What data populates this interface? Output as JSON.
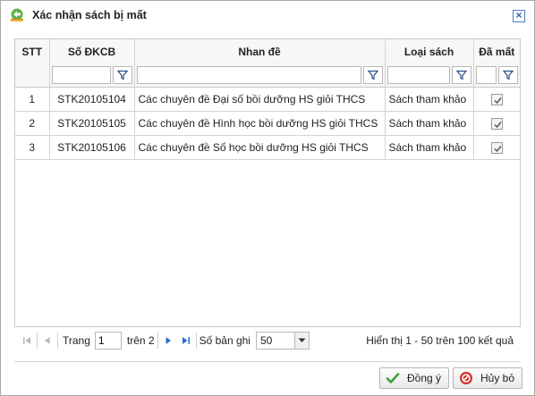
{
  "dialog": {
    "title": "Xác nhận sách bị mất",
    "close_label": "×"
  },
  "table": {
    "columns": [
      "STT",
      "Số ĐKCB",
      "Nhan đề",
      "Loại sách",
      "Đã mất"
    ],
    "rows": [
      {
        "stt": "1",
        "code": "STK20105104",
        "title": "Các chuyên đề Đại số bồi dưỡng HS giỏi THCS",
        "type": "Sách tham khảo",
        "lost": true
      },
      {
        "stt": "2",
        "code": "STK20105105",
        "title": "Các chuyên đề Hình học bồi dưỡng HS giỏi THCS",
        "type": "Sách tham khảo",
        "lost": true
      },
      {
        "stt": "3",
        "code": "STK20105106",
        "title": "Các chuyên đề Số học bồi dưỡng HS giỏi THCS",
        "type": "Sách tham khảo",
        "lost": true
      }
    ]
  },
  "pager": {
    "page_label": "Trang",
    "page_value": "1",
    "of_label": "trên 2",
    "page_size_label": "Số bản ghi",
    "page_size_value": "50",
    "summary": "Hiển thị 1 - 50 trên 100 kết quả"
  },
  "buttons": {
    "confirm": "Đồng ý",
    "cancel": "Hủy bỏ"
  },
  "colors": {
    "accent_blue": "#2a6fc9",
    "confirm_green": "#3aa23a",
    "cancel_red": "#d32f2f"
  }
}
